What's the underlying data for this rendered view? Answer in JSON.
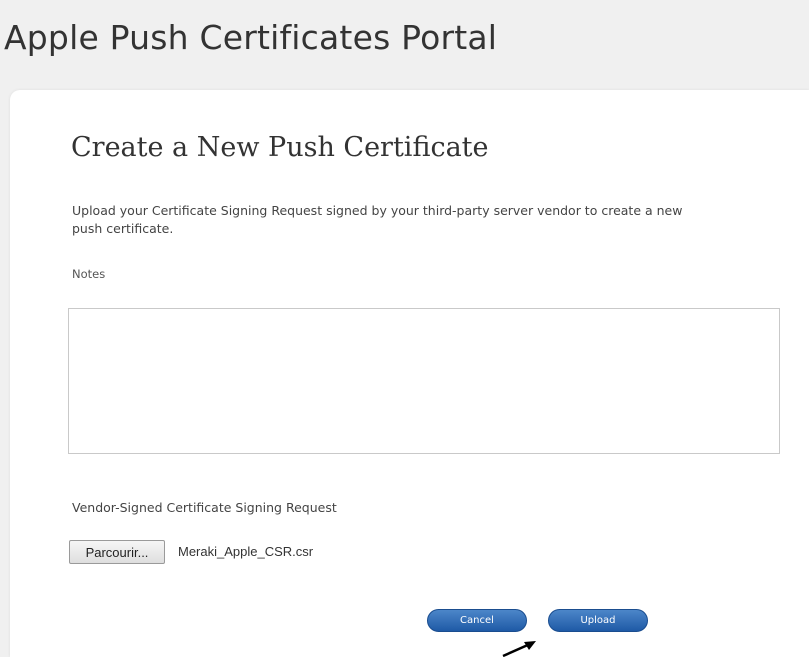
{
  "header": {
    "title": "Apple Push Certificates Portal"
  },
  "form": {
    "title": "Create a New Push Certificate",
    "description": "Upload your Certificate Signing Request signed by your third-party server vendor to create a new push certificate.",
    "notes_label": "Notes",
    "notes_value": "",
    "vendor_label": "Vendor-Signed Certificate Signing Request",
    "browse_label": "Parcourir...",
    "file_name": "Meraki_Apple_CSR.csr",
    "cancel_label": "Cancel",
    "upload_label": "Upload"
  },
  "colors": {
    "accent": "#2a66b0",
    "page_background": "#f0f0f0",
    "card_background": "#ffffff"
  },
  "icons": {
    "cursor": "arrow-cursor-icon"
  }
}
